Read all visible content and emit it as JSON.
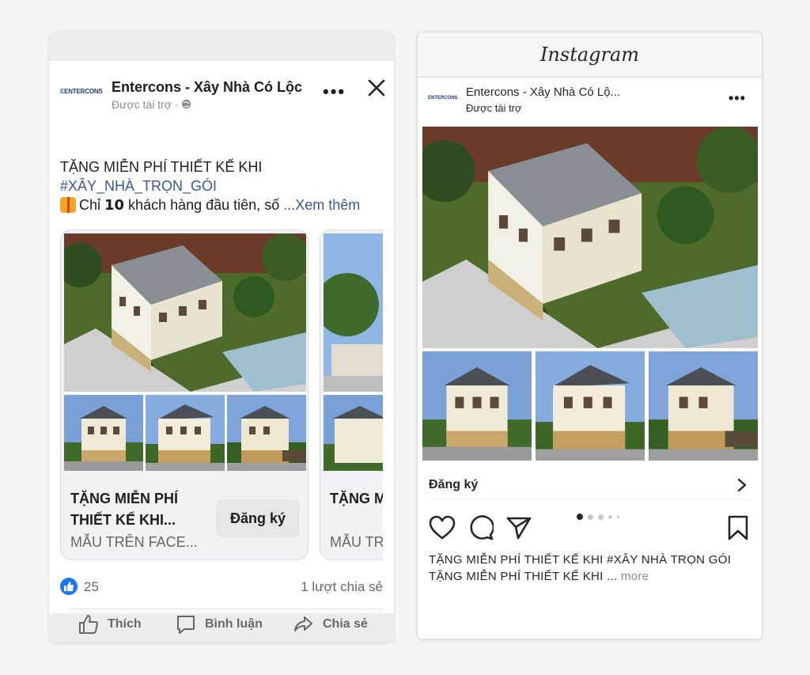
{
  "facebook": {
    "page_name": "Entercons - Xây Nhà Có Lộc",
    "logo_text": "ENTERCONS",
    "sponsored": "Được tài trợ · ",
    "post_line1": "TẶNG MIỄN PHÍ THIẾT KẾ KHI",
    "post_hashtag": "#XÂY_NHÀ_TRỌN_GÓI",
    "post_line3": "Chỉ 𝟭𝟬 khách hàng đầu tiên, số",
    "see_more": "...Xem thêm",
    "cards": [
      {
        "title": "TẶNG MIỄN PHÍ THIẾT KẾ KHI...",
        "description": "MẪU TRÊN FACE...",
        "cta": "Đăng ký"
      },
      {
        "title": "TẶNG M THIẾT K",
        "description": "MẪU TR"
      }
    ],
    "like_count": "25",
    "share_count": "1 lượt chia sẻ",
    "actions": {
      "like": "Thích",
      "comment": "Bình luận",
      "share": "Chia sẻ"
    }
  },
  "instagram": {
    "brand": "Instagram",
    "account_name": "Entercons - Xây Nhà Có Lộ...",
    "logo_text": "ENTERCONS",
    "sponsored": "Được tài trợ",
    "cta": "Đăng ký",
    "caption_line1": "TẶNG MIỄN PHÍ THIẾT KẾ KHI #XÂY NHÀ TRỌN GÓI",
    "caption_line2": "TẶNG MIỄN PHÍ THIẾT KẾ KHI ...",
    "more": "more",
    "carousel_position": 1,
    "carousel_total": 5
  },
  "colors": {
    "fb_blue": "#1877f2",
    "fb_link": "#385898",
    "ig_text": "#262626"
  }
}
